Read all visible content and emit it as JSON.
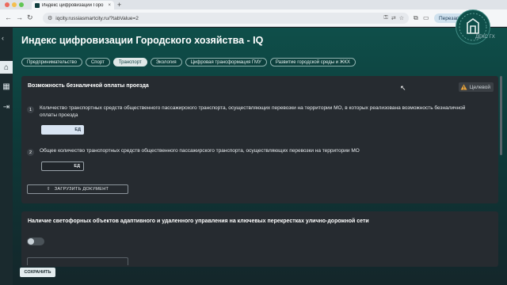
{
  "browser": {
    "tab_title": "Индекс цифровизации Горо",
    "tab_close": "×",
    "new_tab": "+",
    "url": "iqcity.russiasmartcity.ru/?tabValue=2",
    "update_label": "Перезап"
  },
  "header": {
    "title": "Индекс цифровизации Городского хозяйства - IQ",
    "logo_text": "ДЕКС ГХ"
  },
  "tabs": [
    {
      "label": "Предпринимательство"
    },
    {
      "label": "Спорт"
    },
    {
      "label": "Транспорт"
    },
    {
      "label": "Экология"
    },
    {
      "label": "Цифровая трансформация ГМУ"
    },
    {
      "label": "Развитие городской среды и ЖКХ"
    }
  ],
  "active_tab": "Транспорт",
  "card1": {
    "title": "Возможность безналичной оплаты проезда",
    "badge": "Целевой",
    "questions": [
      {
        "num": "1",
        "text": "Количество транспортных средств общественного пассажирского транспорта, осуществляющих перевозки на территории МО, в которых реализована возможность безналичной оплаты проезда",
        "unit": "ЕД"
      },
      {
        "num": "2",
        "text": "Общее количество транспортных средств общественного пассажирского транспорта, осуществляющих перевозки на территории МО",
        "unit": "ЕД"
      }
    ],
    "upload_label": "ЗАГРУЗИТЬ ДОКУМЕНТ"
  },
  "card2": {
    "title": "Наличие светофорных объектов адаптивного и удаленного управления на ключевых перекрестках улично-дорожной сети",
    "toggle_on": false
  },
  "save_label": "СОХРАНИТЬ",
  "colors": {
    "accent": "#0f4f4a",
    "card": "#262b30",
    "active_pill": "#dfe8e8",
    "input_filled": "#d8e4f2"
  }
}
